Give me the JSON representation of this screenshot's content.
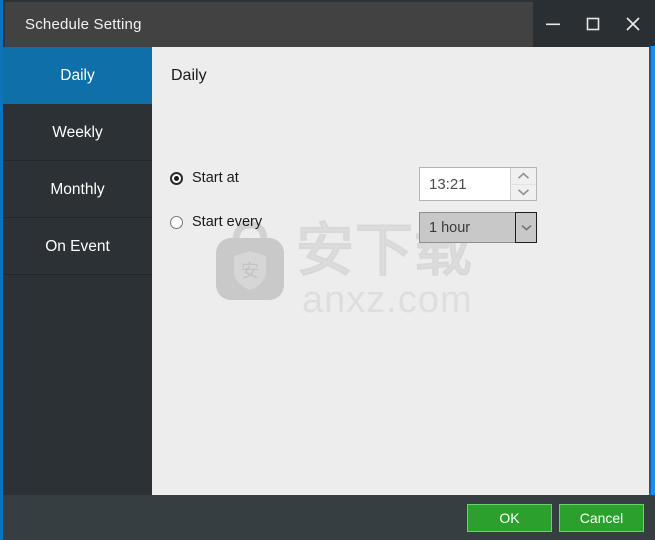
{
  "window": {
    "title": "Schedule Setting",
    "controls": [
      {
        "name": "minimize",
        "icon": "minimize-icon"
      },
      {
        "name": "maximize",
        "icon": "maximize-icon"
      },
      {
        "name": "close",
        "icon": "close-icon"
      }
    ]
  },
  "sidebar": {
    "items": [
      {
        "label": "Daily",
        "active": true
      },
      {
        "label": "Weekly",
        "active": false
      },
      {
        "label": "Monthly",
        "active": false
      },
      {
        "label": "On Event",
        "active": false
      }
    ]
  },
  "main": {
    "title": "Daily",
    "options": [
      {
        "label": "Start at",
        "selected": true,
        "control": "spinbox",
        "value": "13:21",
        "spin_up_icon": "chevron-up-icon",
        "spin_down_icon": "chevron-down-icon"
      },
      {
        "label": "Start every",
        "selected": false,
        "control": "combobox",
        "value": "1 hour",
        "dropdown_icon": "chevron-down-icon"
      }
    ]
  },
  "watermark": {
    "characters": "安下载",
    "domain": "anxz.com",
    "bag_icon": "shopping-bag-icon",
    "shield_character": "安"
  },
  "footer": {
    "ok_label": "OK",
    "cancel_label": "Cancel"
  },
  "colors": {
    "accent_blue": "#0f6fa8",
    "edge_blue": "#1a8cf0",
    "titlebar_gray": "#424242",
    "sidebar_dark": "#2b3135",
    "content_bg": "#ededed",
    "footer_bg": "#373e42",
    "button_green": "#2ba02c",
    "button_green_border": "#6fd06f"
  }
}
